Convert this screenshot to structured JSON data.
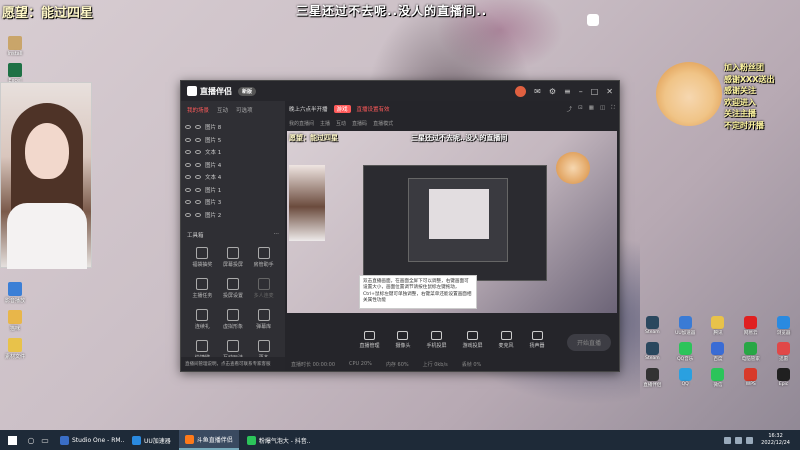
{
  "overlay": {
    "title": "愿望：能过四星",
    "subtitle": "三星还过不去呢..没人的直播间.."
  },
  "desktop_left_icons": [
    {
      "label": "Install",
      "color": "#c9a56a"
    },
    {
      "label": "Excel 2016",
      "color": "#1e7145"
    },
    {
      "label": "Word",
      "color": "#2b579a"
    }
  ],
  "desktop_left_icons_lower": [
    {
      "label": "影音播放",
      "color": "#3b7fd6"
    },
    {
      "label": "猫咪",
      "color": "#e8b64a"
    },
    {
      "label": "素材文件",
      "color": "#e8c24a"
    }
  ],
  "app": {
    "logo": "直播伴侣",
    "version": "新版",
    "tabs": [
      "我的场景",
      "互动",
      "可选项"
    ],
    "sources": [
      "图片 8",
      "图片 5",
      "文本 1",
      "图片 4",
      "文本 4",
      "图片 1",
      "图片 3",
      "图片 2"
    ],
    "tools_title": "工具箱",
    "tools": [
      {
        "label": "福袋抽奖",
        "dim": false
      },
      {
        "label": "屏幕投屏",
        "dim": false
      },
      {
        "label": "房管助手",
        "dim": false
      },
      {
        "label": "主播任务",
        "dim": false
      },
      {
        "label": "投屏设置",
        "dim": false
      },
      {
        "label": "多人连麦",
        "dim": true
      },
      {
        "label": "连续礼",
        "dim": false
      },
      {
        "label": "虚拟形象",
        "dim": false
      },
      {
        "label": "弹幕库",
        "dim": false
      },
      {
        "label": "快捷键",
        "dim": false
      },
      {
        "label": "互动玩法",
        "dim": false
      },
      {
        "label": "更多",
        "dim": false
      }
    ],
    "hint": "直播间管理说明，点击查看可联系专家客服",
    "infobar": {
      "title": "晚上六点半开播",
      "tag": "游戏",
      "tag2": "直播设置有效",
      "line2": [
        "我的直播间",
        "主播",
        "互动",
        "直播码",
        "直播模式"
      ]
    },
    "canvas_overlay_title": "愿望：能过四星",
    "canvas_overlay_sub": "三星还过不去呢..没人的直播间",
    "tooltip": "双击直播画面，在画面全屏下可以调整，右键画面可设置大小，画面位置调节请按住鼠标左键拖动，Ctrl+鼠标左键可单独调整，右键菜单还能设置画面相关属性功能",
    "controls": [
      "直播管理",
      "摄像头",
      "手机投屏",
      "游戏投屏",
      "麦克风",
      "扬声器"
    ],
    "start_label": "开始直播",
    "status": [
      "直播时长 00:00:00",
      "CPU 20%",
      "内存 60%",
      "上行 0kb/s",
      "丢帧 0%"
    ]
  },
  "chat_overlay": [
    "加入粉丝团",
    "感谢XXX送出",
    "感谢关注",
    "欢迎进入",
    "关注主播",
    "不定时开播"
  ],
  "desktop_right_icons": [
    {
      "label": "Steam",
      "color": "#2a475e"
    },
    {
      "label": "UU加速器",
      "color": "#3a7bd5"
    },
    {
      "label": "腾讯",
      "color": "#e8c24a"
    },
    {
      "label": "网易云",
      "color": "#e02020"
    },
    {
      "label": "浏览器",
      "color": "#2a8ae0"
    },
    {
      "label": "Steam",
      "color": "#2a475e"
    },
    {
      "label": "QQ音乐",
      "color": "#2cc45a"
    },
    {
      "label": "百度",
      "color": "#3a6cd5"
    },
    {
      "label": "电脑管家",
      "color": "#28a745"
    },
    {
      "label": "迅雷",
      "color": "#e04848"
    },
    {
      "label": "直播伴侣",
      "color": "#333333"
    },
    {
      "label": "QQ",
      "color": "#2aa0e0"
    },
    {
      "label": "微信",
      "color": "#2cc45a"
    },
    {
      "label": "WPS",
      "color": "#d83a2a"
    },
    {
      "label": "Epic",
      "color": "#202020"
    }
  ],
  "taskbar": {
    "tasks": [
      {
        "label": "Studio One - RM...",
        "color": "#3a6ec6",
        "active": false
      },
      {
        "label": "UU加速器",
        "color": "#2a8ae0",
        "active": false
      },
      {
        "label": "斗鱼直播伴侣",
        "color": "#ff7a1a",
        "active": true
      },
      {
        "label": "粉爆气泡大 - 抖音...",
        "color": "#2cc45a",
        "active": false
      }
    ],
    "time": "16:32",
    "date": "2022/12/24"
  }
}
